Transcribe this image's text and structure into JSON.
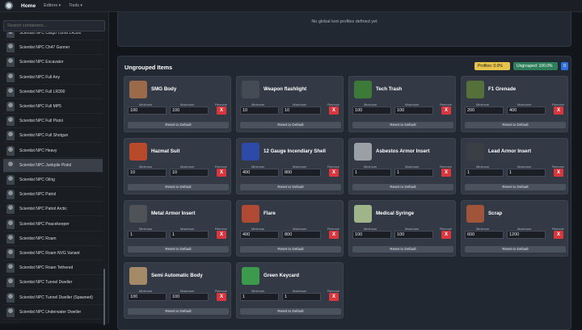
{
  "nav": {
    "home": "Home",
    "editors": "Editors",
    "tools": "Tools"
  },
  "sidebar": {
    "search_placeholder": "Search containers...",
    "items": [
      "Scientist NPC Cargo Turret LR300",
      "Scientist NPC Ch47 Gunner",
      "Scientist NPC Excavator",
      "Scientist NPC Full Any",
      "Scientist NPC Full LR300",
      "Scientist NPC Full MP5",
      "Scientist NPC Full Pistol",
      "Scientist NPC Full Shotgun",
      "Scientist NPC Heavy",
      "Scientist NPC Junkpile Pistol",
      "Scientist NPC Oilrig",
      "Scientist NPC Patrol",
      "Scientist NPC Patrol Arctic",
      "Scientist NPC Peacekeeper",
      "Scientist NPC Roam",
      "Scientist NPC Roam NVG Variant",
      "Scientist NPC Roam Tethered",
      "Scientist NPC Tunnel Dweller",
      "Scientist NPC Tunnel Dweller (Spawned)",
      "Scientist NPC Underwater Dweller"
    ],
    "selected_index": 9
  },
  "main": {
    "no_global": "No global loot profiles defined yet",
    "group_title": "Ungrouped Items",
    "badge_profiles": "Profiles: 0.0%",
    "badge_ungrouped": "Ungrouped: 100.0%",
    "badge_blue": "0",
    "labels": {
      "min": "Minimum",
      "max": "Maximum",
      "remove": "Remove",
      "remove_btn": "X",
      "reset": "Reset to Default"
    },
    "cards": [
      {
        "name": "SMG Body",
        "min": "100",
        "max": "100",
        "color": "#9a6a4a"
      },
      {
        "name": "Weapon flashlight",
        "min": "10",
        "max": "10",
        "color": "#444b54"
      },
      {
        "name": "Tech Trash",
        "min": "100",
        "max": "100",
        "color": "#3d7a3a"
      },
      {
        "name": "F1 Grenade",
        "min": "200",
        "max": "400",
        "color": "#56703a"
      },
      {
        "name": "Hazmat Suit",
        "min": "10",
        "max": "10",
        "color": "#b84a2c"
      },
      {
        "name": "12 Gauge Incendiary Shell",
        "min": "400",
        "max": "800",
        "color": "#2d4aa8"
      },
      {
        "name": "Asbestos Armor Insert",
        "min": "1",
        "max": "1",
        "color": "#9aa0a6"
      },
      {
        "name": "Lead Armor Insert",
        "min": "1",
        "max": "1",
        "color": "#3b3f44"
      },
      {
        "name": "Metal Armor Insert",
        "min": "1",
        "max": "1",
        "color": "#4f5358"
      },
      {
        "name": "Flare",
        "min": "400",
        "max": "800",
        "color": "#b04a34"
      },
      {
        "name": "Medical Syringe",
        "min": "100",
        "max": "100",
        "color": "#a0b48a"
      },
      {
        "name": "Scrap",
        "min": "600",
        "max": "1200",
        "color": "#a0553a"
      },
      {
        "name": "Semi Automatic Body",
        "min": "100",
        "max": "100",
        "color": "#a58a68"
      },
      {
        "name": "Green Keycard",
        "min": "1",
        "max": "1",
        "color": "#3c9a4c"
      }
    ]
  }
}
